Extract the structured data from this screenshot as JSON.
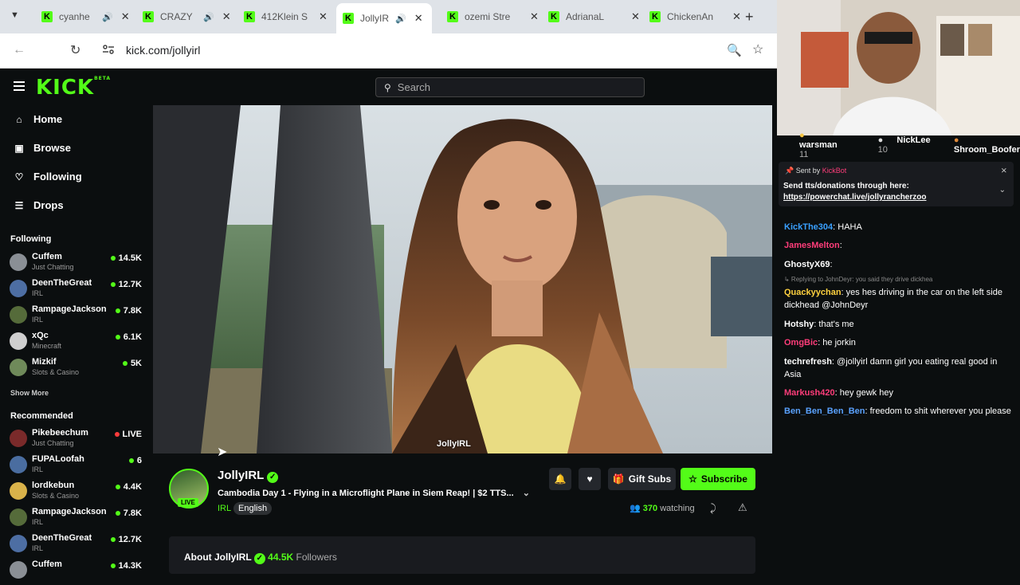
{
  "browser": {
    "tabs": [
      {
        "title": "cyanhe",
        "active": false
      },
      {
        "title": "CRAZY",
        "active": false
      },
      {
        "title": "412Klein S",
        "active": false
      },
      {
        "title": "JollyIR",
        "active": true
      },
      {
        "title": "ozemi Stre",
        "active": false
      },
      {
        "title": "AdrianaL",
        "active": false
      },
      {
        "title": "ChickenAn",
        "active": false
      }
    ],
    "url": "kick.com/jollyirl"
  },
  "header": {
    "logo": "KICK",
    "logo_badge": "BETA",
    "search_placeholder": "Search"
  },
  "nav": {
    "home": "Home",
    "browse": "Browse",
    "following": "Following",
    "drops": "Drops"
  },
  "sidebar": {
    "following_title": "Following",
    "following": [
      {
        "name": "Cuffem",
        "category": "Just Chatting",
        "viewers": "14.5K",
        "color": "#8a8f95"
      },
      {
        "name": "DeenTheGreat",
        "category": "IRL",
        "viewers": "12.7K",
        "color": "#4d6ea3"
      },
      {
        "name": "RampageJackson",
        "category": "IRL",
        "viewers": "7.8K",
        "color": "#556b3a"
      },
      {
        "name": "xQc",
        "category": "Minecraft",
        "viewers": "6.1K",
        "color": "#cfcfcf"
      },
      {
        "name": "Mizkif",
        "category": "Slots & Casino",
        "viewers": "5K",
        "color": "#6f8a5a"
      }
    ],
    "show_more": "Show More",
    "recommended_title": "Recommended",
    "recommended": [
      {
        "name": "Pikebeechum",
        "category": "Just Chatting",
        "viewers": "LIVE",
        "color": "#7a2a2a"
      },
      {
        "name": "FUPALoofah",
        "category": "IRL",
        "viewers": "6",
        "color": "#4a6da0"
      },
      {
        "name": "lordkebun",
        "category": "Slots & Casino",
        "viewers": "4.4K",
        "color": "#d9b24a"
      },
      {
        "name": "RampageJackson",
        "category": "IRL",
        "viewers": "7.8K",
        "color": "#556b3a"
      },
      {
        "name": "DeenTheGreat",
        "category": "IRL",
        "viewers": "12.7K",
        "color": "#4d6ea3"
      },
      {
        "name": "Cuffem",
        "category": "",
        "viewers": "14.3K",
        "color": "#8a8f95"
      }
    ]
  },
  "stream": {
    "watermark": "JollyIRL",
    "streamer": "JollyIRL",
    "live_badge": "LIVE",
    "title": "Cambodia Day 1 - Flying in a Microflight Plane in Siem Reap! | $2 TTS...",
    "category": "IRL",
    "language": "English",
    "gift_subs": "Gift Subs",
    "subscribe": "Subscribe",
    "viewers": "370",
    "watching_label": "watching",
    "about_label": "About JollyIRL",
    "followers_count": "44.5K",
    "followers_label": "Followers"
  },
  "chat": {
    "leaderboard": [
      {
        "name": "warsman",
        "count": "11"
      },
      {
        "name": "NickLee",
        "count": "10"
      },
      {
        "name": "Shroom_Boofer",
        "count": ""
      }
    ],
    "pinned": {
      "sent_by": "Sent by",
      "sender": "KickBot",
      "line1": "Send tts/donations through here:",
      "link": "https://powerchat.live/jollyrancherzoo"
    },
    "messages": [
      {
        "user": "KickThe304",
        "color": "#3aa0ff",
        "text": "HAHA"
      },
      {
        "user": "JamesMelton",
        "color": "#ff3d7a",
        "text": ""
      },
      {
        "user": "GhostyX69",
        "color": "#fff",
        "text": ""
      },
      {
        "reply": "Replying to JohnDeyr: you said they drive dickhea"
      },
      {
        "user": "Quackyychan",
        "color": "#ffd23f",
        "text": "yes hes driving in the car on the left side dickhead @JohnDeyr"
      },
      {
        "user": "Hotshy",
        "color": "#fff",
        "text": "that's me"
      },
      {
        "user": "OmgBic",
        "color": "#ff3d7a",
        "text": "he jorkin"
      },
      {
        "user": "techrefresh",
        "color": "#fff",
        "text": "@jollyirl damn girl you eating real good in Asia"
      },
      {
        "user": "Markush420",
        "color": "#ff3d7a",
        "text": "hey gewk hey"
      },
      {
        "user": "Ben_Ben_Ben_Ben",
        "color": "#5aa2ff",
        "text": "freedom to shit wherever you please"
      }
    ]
  }
}
